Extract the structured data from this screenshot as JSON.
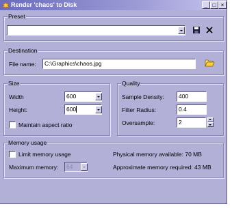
{
  "window": {
    "title": "Render 'chaos' to Disk",
    "minimize_glyph": "_",
    "maximize_glyph": "□",
    "close_glyph": "×"
  },
  "preset": {
    "group_label": "Preset",
    "value": ""
  },
  "destination": {
    "group_label": "Destination",
    "file_name_label": "File name:",
    "file_name_value": "C:\\Graphics\\chaos.jpg"
  },
  "size": {
    "group_label": "Size",
    "width_label": "Width",
    "width_value": "600",
    "height_label": "Height:",
    "height_value": "600",
    "aspect_label": "Maintain aspect ratio"
  },
  "quality": {
    "group_label": "Quality",
    "density_label": "Sample Density:",
    "density_value": "400",
    "radius_label": "Filter Radius:",
    "radius_value": "0.4",
    "oversample_label": "Oversample:",
    "oversample_value": "2"
  },
  "memory": {
    "group_label": "Memory usage",
    "limit_label": "Limit memory usage",
    "max_label": "Maximum memory:",
    "max_value": "64",
    "physical_text": "Physical memory available: 70 MB",
    "approx_text": "Approximate memory required: 43 MB"
  },
  "icons": {
    "app": "app-flame-icon",
    "save": "floppy-save-icon",
    "delete": "delete-x-icon",
    "browse": "open-folder-icon"
  },
  "colors": {
    "window_bg": "#b3b0d8",
    "titlebar_start": "#6a6cbc",
    "titlebar_end": "#c6c4ec",
    "field_bg": "#ffffff"
  }
}
